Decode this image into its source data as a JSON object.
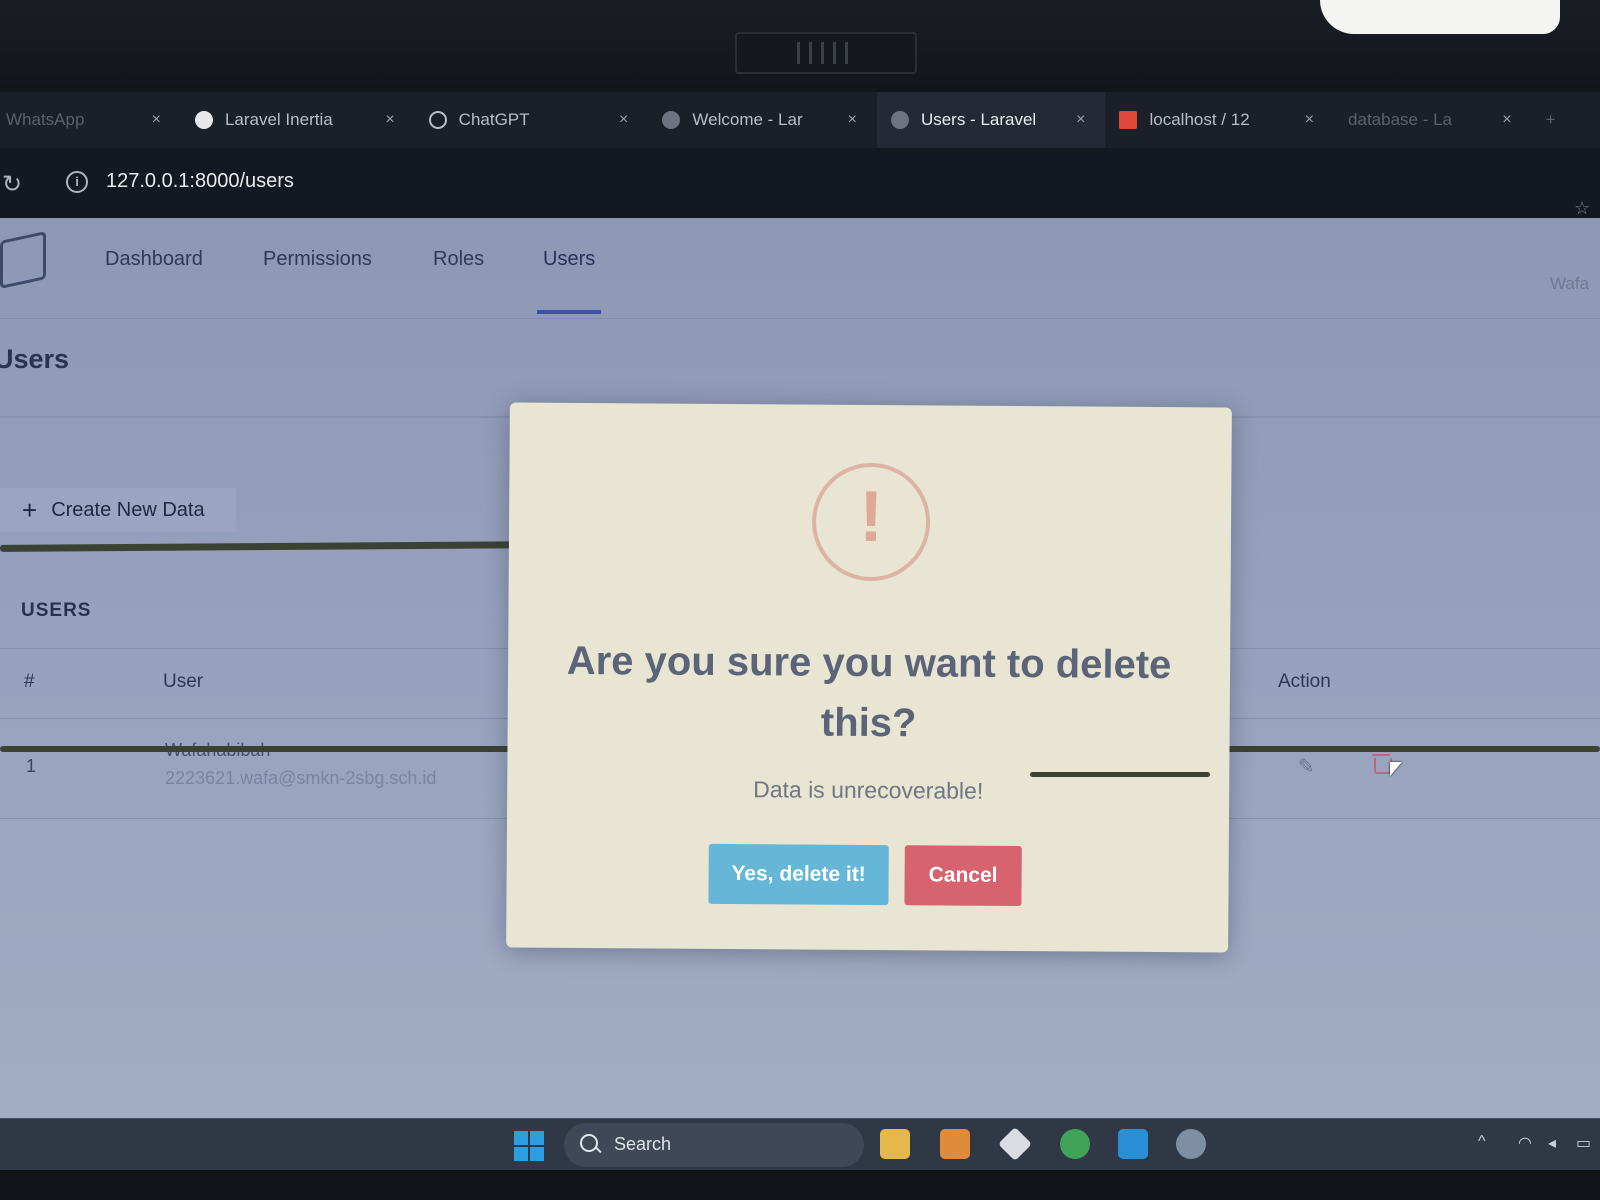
{
  "browser": {
    "tabs": [
      {
        "title": "WhatsApp",
        "state": "faded"
      },
      {
        "title": "Laravel Inertia",
        "state": "normal"
      },
      {
        "title": "ChatGPT",
        "state": "normal"
      },
      {
        "title": "Welcome - Lar",
        "state": "normal"
      },
      {
        "title": "Users - Laravel",
        "state": "active"
      },
      {
        "title": "localhost / 12",
        "state": "normal"
      },
      {
        "title": "database - La",
        "state": "faded"
      }
    ],
    "close_glyph": "×",
    "new_tab_glyph": "+",
    "url": "127.0.0.1:8000/users"
  },
  "nav": {
    "items": [
      "Dashboard",
      "Permissions",
      "Roles",
      "Users"
    ],
    "active": "Users",
    "user": "Wafa"
  },
  "page": {
    "heading": "Users",
    "create_button": "Create New Data",
    "section_label": "USERS"
  },
  "table": {
    "headers": [
      "#",
      "User",
      "Action"
    ],
    "rows": [
      {
        "num": "1",
        "name": "Wafahabibah",
        "email": "2223621.wafa@smkn-2sbg.sch.id"
      }
    ]
  },
  "modal": {
    "title": "Are you sure you want to delete this?",
    "text": "Data is unrecoverable!",
    "confirm_label": "Yes, delete it!",
    "cancel_label": "Cancel",
    "warning_glyph": "!"
  },
  "taskbar": {
    "search_label": "Search"
  },
  "colors": {
    "confirm": "#66b6d8",
    "cancel": "#d7636e",
    "nav_underline": "#3f4fa8"
  }
}
